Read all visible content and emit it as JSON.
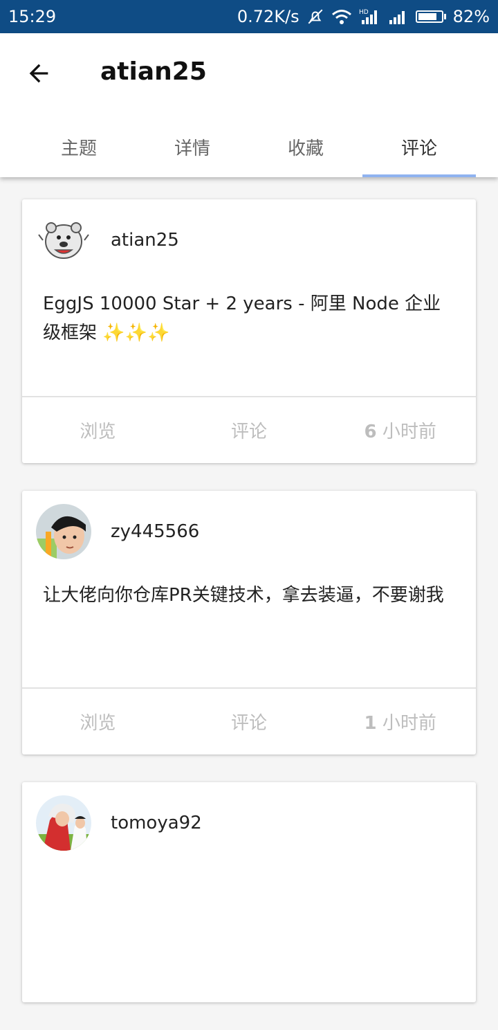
{
  "status_bar": {
    "time": "15:29",
    "net_speed": "0.72K/s",
    "battery": "82%",
    "battery_level": 0.82,
    "icons": [
      "mute-bell-icon",
      "wifi-icon",
      "hd-signal-icon",
      "signal-icon",
      "battery-icon"
    ]
  },
  "header": {
    "back_icon": "arrow-left-icon",
    "title": "atian25"
  },
  "tabs": [
    {
      "label": "主题",
      "active": false
    },
    {
      "label": "详情",
      "active": false
    },
    {
      "label": "收藏",
      "active": false
    },
    {
      "label": "评论",
      "active": true
    }
  ],
  "colors": {
    "status_bar": "#0f4c85",
    "tab_indicator": "#8fb3f0",
    "footer_text": "#bdbdbd"
  },
  "cards": [
    {
      "user": "atian25",
      "avatar": "cartoon-bear-avatar",
      "content": "EggJS 10000 Star + 2 years - 阿里 Node 企业级框架 ✨✨✨",
      "views_label": "浏览",
      "comments_label": "评论",
      "time_num": "6",
      "time_unit": "小时前"
    },
    {
      "user": "zy445566",
      "avatar": "photo-avatar",
      "content": "让大佬向你仓库PR关键技术，拿去装逼，不要谢我",
      "views_label": "浏览",
      "comments_label": "评论",
      "time_num": "1",
      "time_unit": "小时前"
    },
    {
      "user": "tomoya92",
      "avatar": "anime-avatar"
    }
  ]
}
